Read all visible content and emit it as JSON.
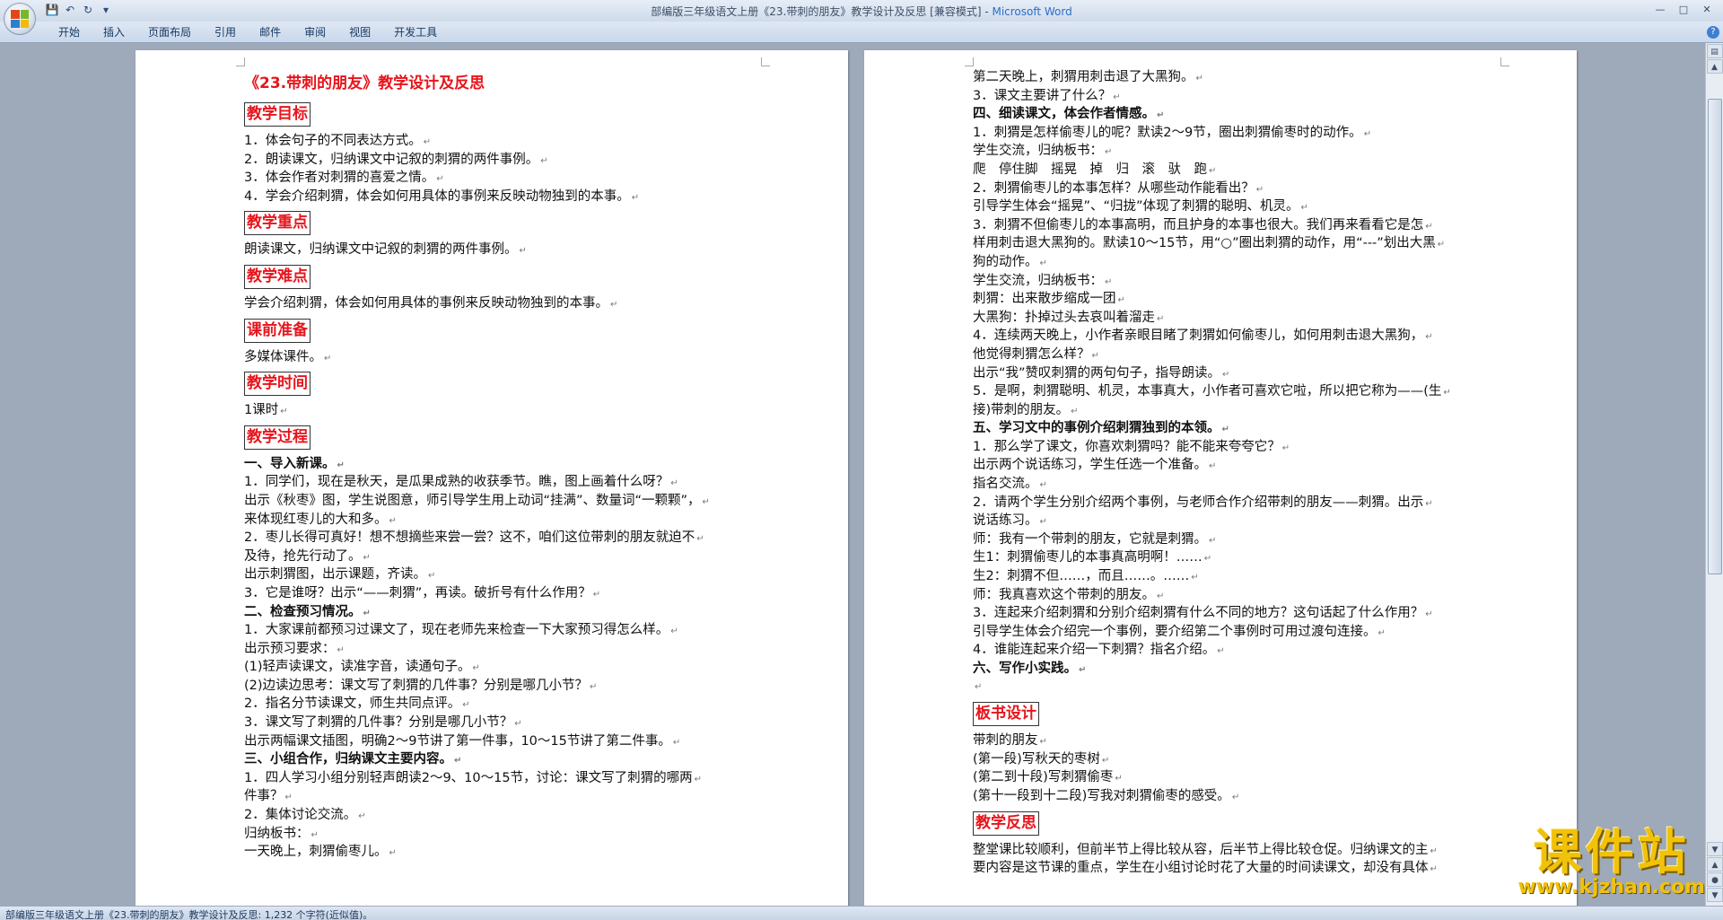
{
  "window": {
    "title": "部编版三年级语文上册《23.带刺的朋友》教学设计及反思 [兼容模式] - ",
    "app_name": "Microsoft Word"
  },
  "ribbon": {
    "tabs": [
      "开始",
      "插入",
      "页面布局",
      "引用",
      "邮件",
      "审阅",
      "视图",
      "开发工具"
    ]
  },
  "document": {
    "left_page": [
      {
        "type": "title",
        "text": "《23.带刺的朋友》教学设计及反思"
      },
      {
        "type": "heading",
        "text": "教学目标"
      },
      {
        "type": "line",
        "text": "1．体会句子的不同表达方式。"
      },
      {
        "type": "line",
        "text": "2．朗读课文，归纳课文中记叙的刺猬的两件事例。"
      },
      {
        "type": "line",
        "text": "3．体会作者对刺猬的喜爱之情。"
      },
      {
        "type": "line",
        "text": "4．学会介绍刺猬，体会如何用具体的事例来反映动物独到的本事。"
      },
      {
        "type": "heading",
        "text": "教学重点"
      },
      {
        "type": "line",
        "text": "朗读课文，归纳课文中记叙的刺猬的两件事例。"
      },
      {
        "type": "heading",
        "text": "教学难点"
      },
      {
        "type": "line",
        "text": "学会介绍刺猬，体会如何用具体的事例来反映动物独到的本事。"
      },
      {
        "type": "heading",
        "text": "课前准备"
      },
      {
        "type": "line",
        "text": "多媒体课件。"
      },
      {
        "type": "heading",
        "text": "教学时间"
      },
      {
        "type": "line",
        "text": "1课时"
      },
      {
        "type": "heading",
        "text": "教学过程"
      },
      {
        "type": "bold",
        "text": "一、导入新课。"
      },
      {
        "type": "line",
        "text": "1．同学们，现在是秋天，是瓜果成熟的收获季节。瞧，图上画着什么呀？"
      },
      {
        "type": "line",
        "text": "出示《秋枣》图，学生说图意，师引导学生用上动词“挂满”、数量词“一颗颗”，"
      },
      {
        "type": "line",
        "text": "来体现红枣儿的大和多。"
      },
      {
        "type": "line",
        "text": "2．枣儿长得可真好！想不想摘些来尝一尝？这不，咱们这位带刺的朋友就迫不"
      },
      {
        "type": "line",
        "text": "及待，抢先行动了。"
      },
      {
        "type": "line",
        "text": "出示刺猬图，出示课题，齐读。"
      },
      {
        "type": "line",
        "text": "3．它是谁呀？出示“——刺猬”，再读。破折号有什么作用？"
      },
      {
        "type": "bold",
        "text": "二、检查预习情况。"
      },
      {
        "type": "line",
        "text": "1．大家课前都预习过课文了，现在老师先来检查一下大家预习得怎么样。"
      },
      {
        "type": "line",
        "text": "出示预习要求："
      },
      {
        "type": "line",
        "text": "(1)轻声读课文，读准字音，读通句子。"
      },
      {
        "type": "line",
        "text": "(2)边读边思考：课文写了刺猬的几件事？分别是哪几小节？"
      },
      {
        "type": "line",
        "text": "2．指名分节读课文，师生共同点评。"
      },
      {
        "type": "line",
        "text": "3．课文写了刺猬的几件事？分别是哪几小节？"
      },
      {
        "type": "line",
        "text": "出示两幅课文插图，明确2～9节讲了第一件事，10～15节讲了第二件事。"
      },
      {
        "type": "bold",
        "text": "三、小组合作，归纳课文主要内容。"
      },
      {
        "type": "line",
        "text": "1．四人学习小组分别轻声朗读2～9、10～15节，讨论：课文写了刺猬的哪两"
      },
      {
        "type": "line",
        "text": "件事？"
      },
      {
        "type": "line",
        "text": "2．集体讨论交流。"
      },
      {
        "type": "line",
        "text": "归纳板书："
      },
      {
        "type": "line",
        "text": "一天晚上，刺猬偷枣儿。"
      }
    ],
    "right_page": [
      {
        "type": "line",
        "text": "第二天晚上，刺猬用刺击退了大黑狗。"
      },
      {
        "type": "line",
        "text": "3．课文主要讲了什么？"
      },
      {
        "type": "bold",
        "text": "四、细读课文，体会作者情感。"
      },
      {
        "type": "line",
        "text": "1．刺猬是怎样偷枣儿的呢？默读2～9节，圈出刺猬偷枣时的动作。"
      },
      {
        "type": "line",
        "text": "学生交流，归纳板书："
      },
      {
        "type": "line",
        "text": "爬　停住脚　摇晃　掉　归　滚　驮　跑"
      },
      {
        "type": "line",
        "text": "2．刺猬偷枣儿的本事怎样？从哪些动作能看出？"
      },
      {
        "type": "line",
        "text": "引导学生体会“摇晃”、“归拢”体现了刺猬的聪明、机灵。"
      },
      {
        "type": "line",
        "text": "3．刺猬不但偷枣儿的本事高明，而且护身的本事也很大。我们再来看看它是怎"
      },
      {
        "type": "line",
        "text": "样用刺击退大黑狗的。默读10～15节，用“○”圈出刺猬的动作，用“---”划出大黑"
      },
      {
        "type": "line",
        "text": "狗的动作。"
      },
      {
        "type": "line",
        "text": "学生交流，归纳板书："
      },
      {
        "type": "line",
        "text": "刺猬：出来散步缩成一团"
      },
      {
        "type": "line",
        "text": "大黑狗：扑掉过头去哀叫着溜走"
      },
      {
        "type": "line",
        "text": "4．连续两天晚上，小作者亲眼目睹了刺猬如何偷枣儿，如何用刺击退大黑狗，"
      },
      {
        "type": "line",
        "text": "他觉得刺猬怎么样？"
      },
      {
        "type": "line",
        "text": "出示“我”赞叹刺猬的两句句子，指导朗读。"
      },
      {
        "type": "line",
        "text": "5．是啊，刺猬聪明、机灵，本事真大，小作者可喜欢它啦，所以把它称为——(生"
      },
      {
        "type": "line",
        "text": "接)带刺的朋友。"
      },
      {
        "type": "bold",
        "text": "五、学习文中的事例介绍刺猬独到的本领。"
      },
      {
        "type": "line",
        "text": "1．那么学了课文，你喜欢刺猬吗？能不能来夸夸它？"
      },
      {
        "type": "line",
        "text": "出示两个说话练习，学生任选一个准备。"
      },
      {
        "type": "line",
        "text": "指名交流。"
      },
      {
        "type": "line",
        "text": "2．请两个学生分别介绍两个事例，与老师合作介绍带刺的朋友——刺猬。出示"
      },
      {
        "type": "line",
        "text": "说话练习。"
      },
      {
        "type": "line",
        "text": "师：我有一个带刺的朋友，它就是刺猬。"
      },
      {
        "type": "line",
        "text": "生1：刺猬偷枣儿的本事真高明啊！……"
      },
      {
        "type": "line",
        "text": "生2：刺猬不但……，而且……。……"
      },
      {
        "type": "line",
        "text": "师：我真喜欢这个带刺的朋友。"
      },
      {
        "type": "line",
        "text": "3．连起来介绍刺猬和分别介绍刺猬有什么不同的地方？这句话起了什么作用？"
      },
      {
        "type": "line",
        "text": "引导学生体会介绍完一个事例，要介绍第二个事例时可用过渡句连接。"
      },
      {
        "type": "line",
        "text": "4．谁能连起来介绍一下刺猬？指名介绍。"
      },
      {
        "type": "bold",
        "text": "六、写作小实践。"
      },
      {
        "type": "blank",
        "text": ""
      },
      {
        "type": "heading",
        "text": "板书设计"
      },
      {
        "type": "line",
        "text": "带刺的朋友"
      },
      {
        "type": "line",
        "text": "(第一段)写秋天的枣树"
      },
      {
        "type": "line",
        "text": "(第二到十段)写刺猬偷枣"
      },
      {
        "type": "line",
        "text": "(第十一段到十二段)写我对刺猬偷枣的感受。"
      },
      {
        "type": "heading",
        "text": "教学反思"
      },
      {
        "type": "line",
        "text": "整堂课比较顺利，但前半节上得比较从容，后半节上得比较仓促。归纳课文的主"
      },
      {
        "type": "line",
        "text": "要内容是这节课的重点，学生在小组讨论时花了大量的时间读课文，却没有具体"
      }
    ]
  },
  "statusbar": {
    "text": "部编版三年级语文上册《23.带刺的朋友》教学设计及反思: 1,232 个字符(近似值)。"
  },
  "watermark": {
    "main": "课件站",
    "url": "www.kjzhan.com"
  },
  "colors": {
    "heading_red": "#e8141b",
    "title_link_blue": "#2a6fc9",
    "watermark_gold": "#f0c20a"
  }
}
